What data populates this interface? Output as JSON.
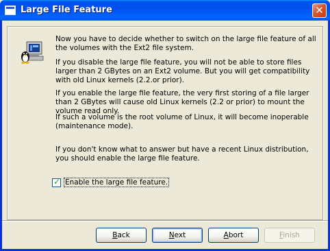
{
  "window": {
    "title": "Large File Feature",
    "close_glyph": "✕"
  },
  "body": {
    "p1": "Now you have to decide whether to switch on the large file feature of all the volumes with the Ext2 file system.",
    "p2": "If you disable the large file feature, you will not be able to store files larger than 2 GBytes on an Ext2 volume. But you will get compatibility with old Linux kernels (2.2.or prior).",
    "p3": "If you enable the large file feature, the very first storing of a file larger than 2 GBytes will cause old Linux kernels (2.2 or prior) to mount the volume read only.",
    "p4": "If such a volume is the root volume of Linux, it will become inoperable (maintenance mode).",
    "p5": "If you don't know what to answer but have a recent Linux distribution, you should enable the large file feature."
  },
  "checkbox": {
    "label": "Enable the large file feature.",
    "checked": true,
    "check_glyph": "✓"
  },
  "buttons": {
    "back": "Back",
    "next": "Next",
    "abort": "Abort",
    "finish": "Finish",
    "finish_disabled": true
  },
  "colors": {
    "titlebar": "#0054e3",
    "face": "#ece9d8",
    "close": "#d85530",
    "check": "#21a121"
  },
  "icons": {
    "title": "window-icon",
    "panel": "linux-penguin-computer-icon"
  }
}
